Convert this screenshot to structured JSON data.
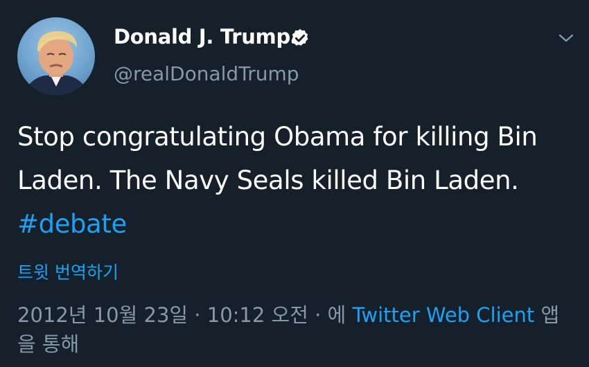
{
  "author": {
    "display_name": "Donald J. Trump",
    "handle": "@realDonaldTrump",
    "verified": true
  },
  "tweet": {
    "text": "Stop congratulating Obama for killing Bin Laden. The Navy Seals killed Bin Laden. ",
    "hashtag": "#debate"
  },
  "actions": {
    "translate_label": "트윗 번역하기",
    "menu_icon": "chevron-down-icon"
  },
  "meta": {
    "timestamp": "2012년 10월 23일 · 10:12 오전 · 에 ",
    "source": "Twitter Web Client",
    "suffix": " 앱을 통해"
  },
  "colors": {
    "background": "#15202b",
    "accent": "#1da1f2",
    "secondary_text": "#8899a6",
    "primary_text": "#ffffff"
  }
}
